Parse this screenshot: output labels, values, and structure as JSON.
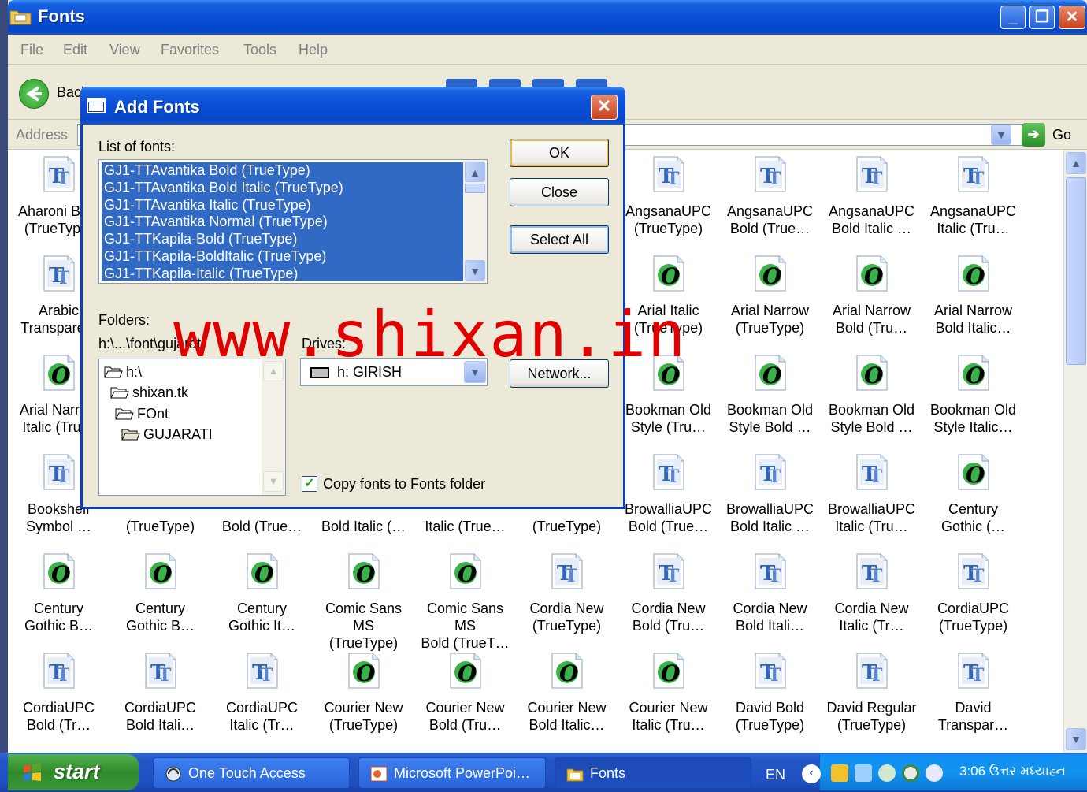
{
  "window": {
    "title": "Fonts",
    "min": "_",
    "max": "❐",
    "close": "✕"
  },
  "menu": [
    "File",
    "Edit",
    "View",
    "Favorites",
    "Tools",
    "Help"
  ],
  "toolbar": {
    "back_label": "Back"
  },
  "address": {
    "label": "Address",
    "go_label": "Go"
  },
  "fonts": [
    {
      "l1": "Aharoni Bold",
      "l2": "(TrueType)",
      "icon": "tt"
    },
    {
      "l1": "AngsanaUPC",
      "l2": "(TrueType)",
      "icon": "tt"
    },
    {
      "l1": "AngsanaUPC",
      "l2": "Bold (True…",
      "icon": "tt"
    },
    {
      "l1": "AngsanaUPC",
      "l2": "Bold Italic …",
      "icon": "tt"
    },
    {
      "l1": "AngsanaUPC",
      "l2": "Italic (Tru…",
      "icon": "tt"
    },
    {
      "l1": "Arabic",
      "l2": "Transparent",
      "icon": "tt"
    },
    {
      "l1": "Arial Italic",
      "l2": "(TrueType)",
      "icon": "o"
    },
    {
      "l1": "Arial Narrow",
      "l2": "(TrueType)",
      "icon": "o"
    },
    {
      "l1": "Arial Narrow",
      "l2": "Bold (Tru…",
      "icon": "o"
    },
    {
      "l1": "Arial Narrow",
      "l2": "Bold Italic…",
      "icon": "o"
    },
    {
      "l1": "Arial Narrow",
      "l2": "Italic (Tru…",
      "icon": "o"
    },
    {
      "l1": "Bookman Old",
      "l2": "Style (Tru…",
      "icon": "o"
    },
    {
      "l1": "Bookman Old",
      "l2": "Style Bold …",
      "icon": "o"
    },
    {
      "l1": "Bookman Old",
      "l2": "Style Bold …",
      "icon": "o"
    },
    {
      "l1": "Bookman Old",
      "l2": "Style Italic…",
      "icon": "o"
    },
    {
      "l1": "Bookshelf",
      "l2": "Symbol …",
      "icon": "tt"
    },
    {
      "l1": "",
      "l2": "(TrueType)",
      "icon": "none"
    },
    {
      "l1": "",
      "l2": "Bold (True…",
      "icon": "none"
    },
    {
      "l1": "",
      "l2": "Bold Italic (…",
      "icon": "none"
    },
    {
      "l1": "",
      "l2": "Italic (True…",
      "icon": "none"
    },
    {
      "l1": "",
      "l2": "(TrueType)",
      "icon": "none"
    },
    {
      "l1": "BrowalliaUPC",
      "l2": "Bold (True…",
      "icon": "tt"
    },
    {
      "l1": "BrowalliaUPC",
      "l2": "Bold Italic …",
      "icon": "tt"
    },
    {
      "l1": "BrowalliaUPC",
      "l2": "Italic (Tru…",
      "icon": "tt"
    },
    {
      "l1": "Century",
      "l2": "Gothic (…",
      "icon": "o"
    },
    {
      "l1": "Century",
      "l2": "Gothic B…",
      "icon": "o"
    },
    {
      "l1": "Century",
      "l2": "Gothic B…",
      "icon": "o"
    },
    {
      "l1": "Century",
      "l2": "Gothic It…",
      "icon": "o"
    },
    {
      "l1": "Comic Sans MS",
      "l2": "(TrueType)",
      "icon": "o"
    },
    {
      "l1": "Comic Sans MS",
      "l2": "Bold (TrueT…",
      "icon": "o"
    },
    {
      "l1": "Cordia New",
      "l2": "(TrueType)",
      "icon": "tt"
    },
    {
      "l1": "Cordia New",
      "l2": "Bold (Tru…",
      "icon": "tt"
    },
    {
      "l1": "Cordia New",
      "l2": "Bold Itali…",
      "icon": "tt"
    },
    {
      "l1": "Cordia New",
      "l2": "Italic (Tr…",
      "icon": "tt"
    },
    {
      "l1": "CordiaUPC",
      "l2": "(TrueType)",
      "icon": "tt"
    },
    {
      "l1": "CordiaUPC",
      "l2": "Bold (Tr…",
      "icon": "tt"
    },
    {
      "l1": "CordiaUPC",
      "l2": "Bold Itali…",
      "icon": "tt"
    },
    {
      "l1": "CordiaUPC",
      "l2": "Italic (Tr…",
      "icon": "tt"
    },
    {
      "l1": "Courier New",
      "l2": "(TrueType)",
      "icon": "o"
    },
    {
      "l1": "Courier New",
      "l2": "Bold (Tru…",
      "icon": "o"
    },
    {
      "l1": "Courier New",
      "l2": "Bold Italic…",
      "icon": "o"
    },
    {
      "l1": "Courier New",
      "l2": "Italic (Tru…",
      "icon": "o"
    },
    {
      "l1": "David Bold",
      "l2": "(TrueType)",
      "icon": "tt"
    },
    {
      "l1": "David Regular",
      "l2": "(TrueType)",
      "icon": "tt"
    },
    {
      "l1": "David",
      "l2": "Transpar…",
      "icon": "tt"
    }
  ],
  "dialog": {
    "title": "Add Fonts",
    "close": "✕",
    "list_label": "List of fonts:",
    "list_items": [
      "GJ1-TTAvantika Bold (TrueType)",
      "GJ1-TTAvantika Bold Italic (TrueType)",
      "GJ1-TTAvantika Italic (TrueType)",
      "GJ1-TTAvantika Normal (TrueType)",
      "GJ1-TTKapila-Bold (TrueType)",
      "GJ1-TTKapila-BoldItalic (TrueType)",
      "GJ1-TTKapila-Italic (TrueType)"
    ],
    "ok": "OK",
    "close_btn": "Close",
    "select_all": "Select All",
    "network": "Network...",
    "folders_label": "Folders:",
    "folder_path": "h:\\...\\font\\gujarati",
    "tree": [
      "h:\\",
      "shixan.tk",
      "FOnt",
      "GUJARATI"
    ],
    "drives_label": "Drives:",
    "drive_value": "h: GIRISH",
    "copy_checked": true,
    "copy_mark": "✓",
    "copy_label": "Copy fonts to Fonts folder"
  },
  "watermark": "www.shixan.in",
  "taskbar": {
    "start": "start",
    "tasks": [
      "One Touch Access",
      "Microsoft PowerPoi…",
      "Fonts"
    ],
    "lang": "EN",
    "clock": "3:06 ઉત્તર મધ્યાહ્ન"
  }
}
